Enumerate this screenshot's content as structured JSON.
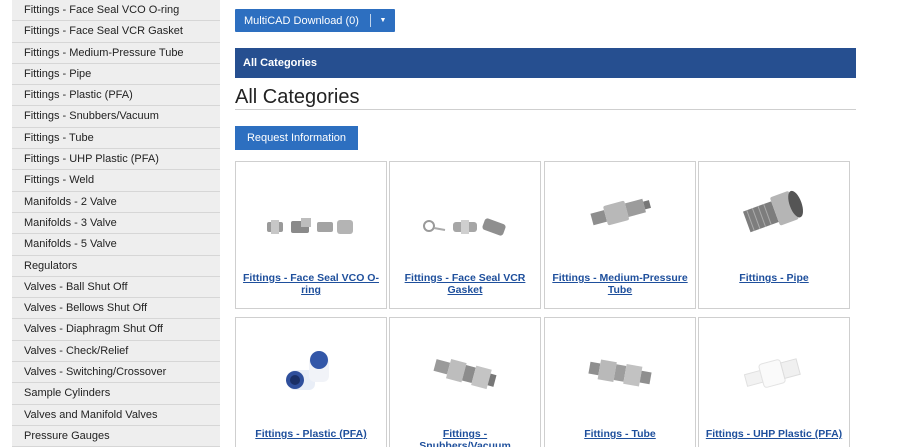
{
  "sidebar": {
    "items": [
      "Fittings - Face Seal VCO O-ring",
      "Fittings - Face Seal VCR Gasket",
      "Fittings - Medium-Pressure Tube",
      "Fittings - Pipe",
      "Fittings - Plastic (PFA)",
      "Fittings - Snubbers/Vacuum",
      "Fittings - Tube",
      "Fittings - UHP Plastic (PFA)",
      "Fittings - Weld",
      "Manifolds - 2 Valve",
      "Manifolds - 3 Valve",
      "Manifolds - 5 Valve",
      "Regulators",
      "Valves - Ball Shut Off",
      "Valves - Bellows Shut Off",
      "Valves - Diaphragm Shut Off",
      "Valves - Check/Relief",
      "Valves - Switching/Crossover",
      "Sample Cylinders",
      "Valves and Manifold Valves",
      "Pressure Gauges"
    ]
  },
  "toolbar": {
    "multicad_label": "MultiCAD Download (0)",
    "caret": "▼"
  },
  "category_bar": {
    "label": "All Categories"
  },
  "page": {
    "title": "All Categories",
    "request_label": "Request Information"
  },
  "products": [
    {
      "name": "Fittings - Face Seal VCO O-ring",
      "icon": "vco-fittings-icon"
    },
    {
      "name": "Fittings - Face Seal VCR Gasket",
      "icon": "vcr-fittings-icon"
    },
    {
      "name": "Fittings - Medium-Pressure Tube",
      "icon": "medium-pressure-fitting-icon"
    },
    {
      "name": "Fittings - Pipe",
      "icon": "pipe-fitting-icon"
    },
    {
      "name": "Fittings - Plastic (PFA)",
      "icon": "plastic-elbow-icon"
    },
    {
      "name": "Fittings - Snubbers/Vacuum",
      "icon": "snubber-fitting-icon"
    },
    {
      "name": "Fittings - Tube",
      "icon": "tube-union-icon"
    },
    {
      "name": "Fittings - UHP Plastic (PFA)",
      "icon": "uhp-plastic-fitting-icon"
    }
  ]
}
